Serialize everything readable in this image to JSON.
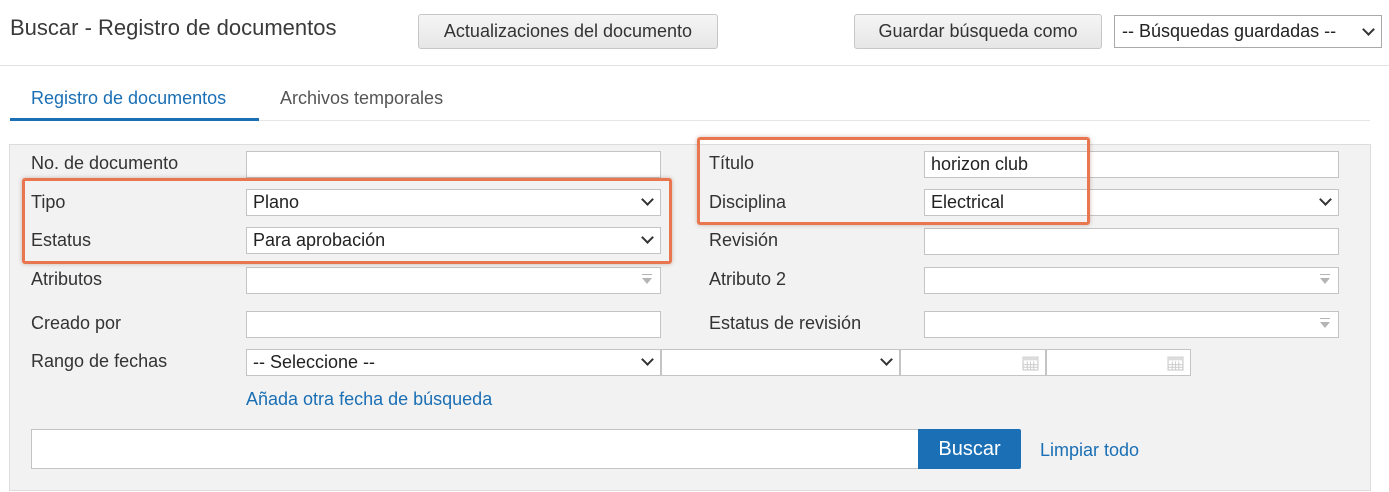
{
  "header": {
    "title": "Buscar - Registro de documentos",
    "updates_button": "Actualizaciones del documento",
    "save_search_button": "Guardar búsqueda como",
    "saved_searches_select": "-- Búsquedas guardadas --"
  },
  "tabs": [
    {
      "label": "Registro de documentos",
      "active": true
    },
    {
      "label": "Archivos temporales",
      "active": false
    }
  ],
  "form": {
    "doc_number": {
      "label": "No. de documento",
      "value": ""
    },
    "tipo": {
      "label": "Tipo",
      "value": "Plano"
    },
    "estatus": {
      "label": "Estatus",
      "value": "Para aprobación"
    },
    "atributos": {
      "label": "Atributos",
      "value": ""
    },
    "creado_por": {
      "label": "Creado por",
      "value": ""
    },
    "rango_fechas": {
      "label": "Rango de fechas",
      "value": "-- Seleccione --",
      "second_value": ""
    },
    "titulo": {
      "label": "Título",
      "value": "horizon club"
    },
    "disciplina": {
      "label": "Disciplina",
      "value": "Electrical"
    },
    "revision": {
      "label": "Revisión",
      "value": ""
    },
    "atributo2": {
      "label": "Atributo 2",
      "value": ""
    },
    "estatus_revision": {
      "label": "Estatus de revisión",
      "value": ""
    },
    "add_date_link": "Añada otra fecha de búsqueda"
  },
  "search": {
    "query": "",
    "button": "Buscar",
    "clear_link": "Limpiar todo"
  },
  "colors": {
    "accent": "#1a6fb5",
    "highlight": "#e8764f",
    "panel_bg": "#f2f2f2"
  }
}
